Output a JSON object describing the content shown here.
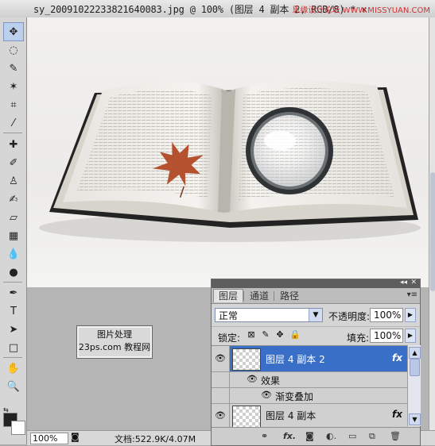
{
  "window": {
    "title": "sy_20091022233821640083.jpg @ 100% (图层 4 副本 2, RGB/8) * ×",
    "watermark": "思缘设计论坛 WWW.MISSYUAN.COM"
  },
  "toolbar": {
    "tools": [
      "move-icon",
      "lasso-icon",
      "quick-select-icon",
      "magic-wand-icon",
      "crop-icon",
      "eyedropper-icon",
      "healing-icon",
      "brush-icon",
      "stamp-icon",
      "history-brush-icon",
      "eraser-icon",
      "gradient-icon",
      "blur-icon",
      "dodge-icon",
      "pen-icon",
      "type-icon",
      "path-select-icon",
      "shape-icon",
      "hand-icon",
      "zoom-icon"
    ],
    "fg_color": "#222222",
    "bg_color": "#ffffff"
  },
  "logo": {
    "line1": "图片处理",
    "line2": "23ps.com 教程网"
  },
  "statusbar": {
    "zoom": "100%",
    "doc_size": "文档:522.9K/4.07M"
  },
  "layers_panel": {
    "tabs": [
      "图层",
      "通道",
      "路径"
    ],
    "blend_mode": "正常",
    "opacity_label": "不透明度:",
    "opacity_value": "100%",
    "lock_label": "锁定:",
    "fill_label": "填充:",
    "fill_value": "100%",
    "layers": [
      {
        "name": "图层 4 副本 2",
        "selected": true,
        "fx": "fx"
      },
      {
        "name": "效果",
        "type": "effects-header"
      },
      {
        "name": "渐变叠加",
        "type": "effect"
      },
      {
        "name": "图层 4 副本",
        "selected": false,
        "fx": "fx"
      }
    ],
    "bottom_icons": [
      "link-icon",
      "fx-icon",
      "mask-icon",
      "adjustment-icon",
      "group-icon",
      "new-layer-icon",
      "trash-icon"
    ]
  },
  "colors": {
    "selection": "#3a6fc7",
    "panel_bg": "#d5d5d5",
    "canvas_bg": "#efeeec"
  }
}
